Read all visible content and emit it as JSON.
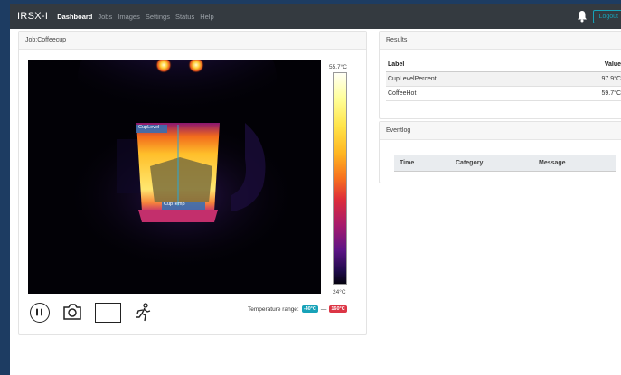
{
  "navbar": {
    "brand": "IRSX-I",
    "links": [
      "Dashboard",
      "Jobs",
      "Images",
      "Settings",
      "Status",
      "Help"
    ],
    "logout": "Logout"
  },
  "job": {
    "title": "Job:Coffeecup",
    "scale_max": "55.7°C",
    "scale_min": "24°C",
    "roi_labels": [
      "CupLevel",
      "CupTemp"
    ],
    "temp_range_label": "Temperature range:",
    "temp_low": "-40°C",
    "temp_sep": "—",
    "temp_high": "160°C",
    "tools": [
      "pause-icon",
      "camera-icon",
      "rectangle-icon",
      "running-person-icon"
    ]
  },
  "results": {
    "title": "Results",
    "columns": [
      "Label",
      "Value"
    ],
    "rows": [
      {
        "label": "CupLevelPercent",
        "value": "97.9°C"
      },
      {
        "label": "CoffeeHot",
        "value": "59.7°C"
      }
    ]
  },
  "eventlog": {
    "title": "Eventlog",
    "columns": [
      "Time",
      "Category",
      "Message"
    ]
  },
  "colors": {
    "navbar": "#343a40",
    "page_bg": "#1d3c62",
    "accent": "#17a2b8",
    "danger": "#dc3545"
  }
}
